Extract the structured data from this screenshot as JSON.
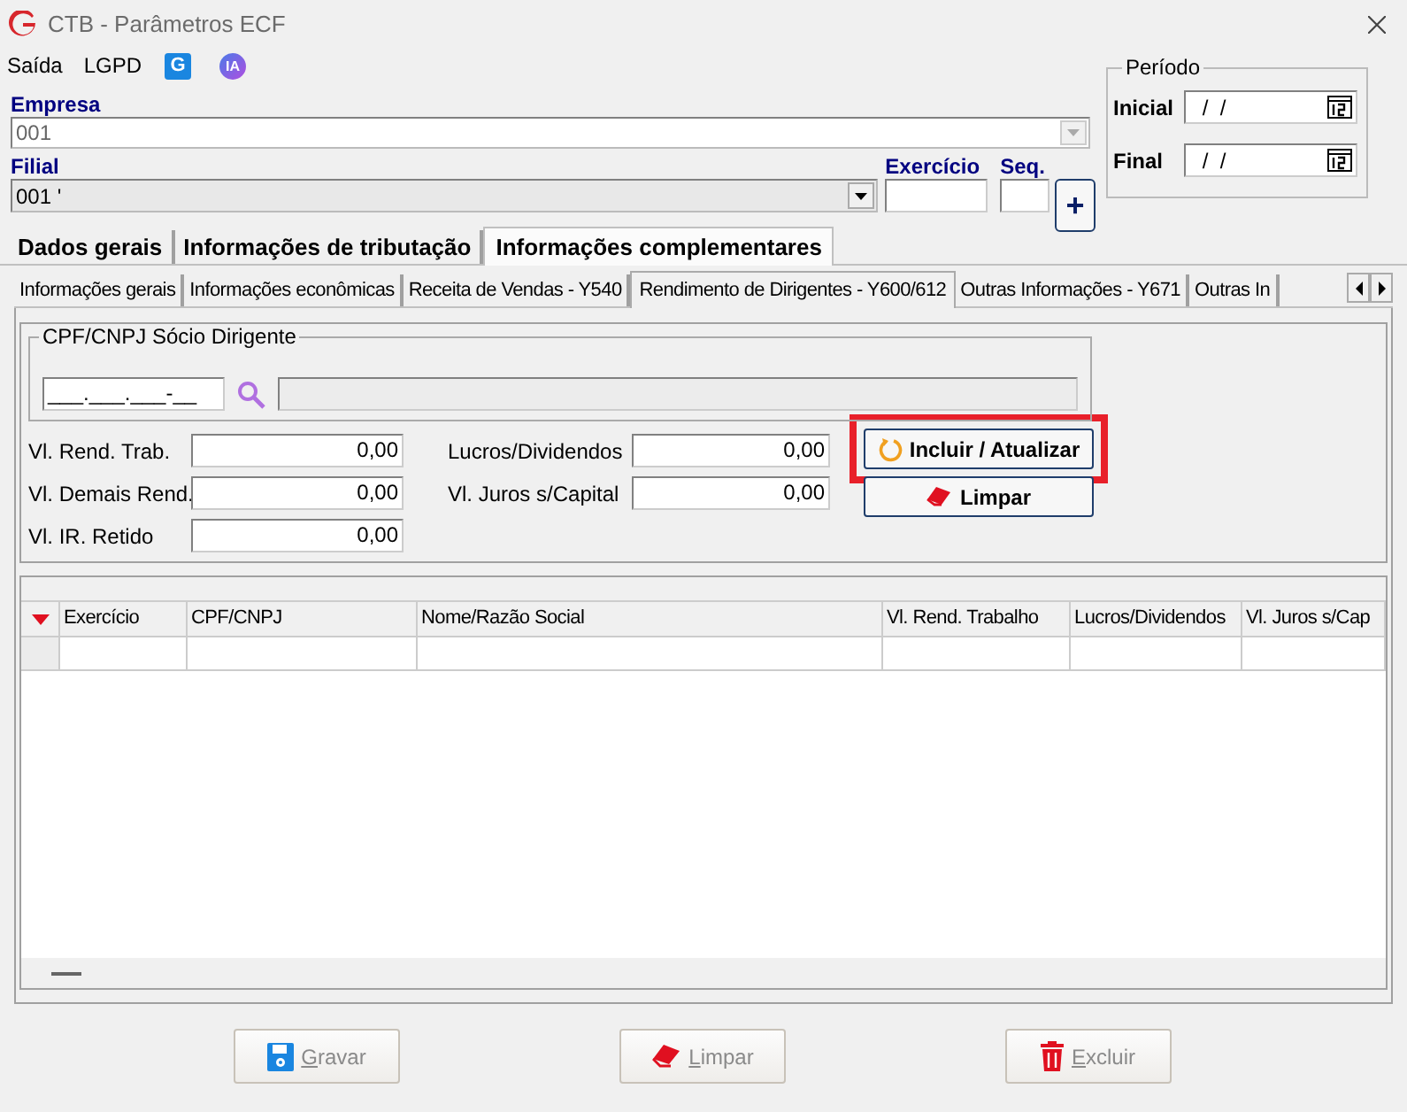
{
  "window": {
    "title": "CTB - Parâmetros ECF"
  },
  "menu": [
    {
      "kind": "text",
      "label": "Saída"
    },
    {
      "kind": "text",
      "label": "LGPD"
    },
    {
      "kind": "square",
      "label": "G"
    },
    {
      "kind": "circle",
      "label": "IA"
    }
  ],
  "empresa": {
    "label": "Empresa",
    "value": "001"
  },
  "filial": {
    "label": "Filial",
    "value": "001 '"
  },
  "exercicio": {
    "label": "Exercício"
  },
  "seq": {
    "label": "Seq."
  },
  "add_button": {
    "label": "+"
  },
  "periodo": {
    "title": "Período",
    "fields": [
      {
        "label": "Inicial",
        "value": " /  /"
      },
      {
        "label": "Final",
        "value": " /  /"
      }
    ]
  },
  "main_tabs": [
    {
      "label": "Dados gerais",
      "selected": false
    },
    {
      "label": "Informações de tributação",
      "selected": false
    },
    {
      "label": "Informações complementares",
      "selected": true
    }
  ],
  "sub_tabs": [
    {
      "label": "Informações gerais",
      "selected": false
    },
    {
      "label": "Informações econômicas",
      "selected": false
    },
    {
      "label": "Receita de Vendas - Y540",
      "selected": false
    },
    {
      "label": "Rendimento de Dirigentes - Y600/612",
      "selected": true
    },
    {
      "label": "Outras Informações - Y671",
      "selected": false
    },
    {
      "label": "Outras In",
      "selected": false
    }
  ],
  "dirigente": {
    "title": "CPF/CNPJ Sócio Dirigente",
    "value": "___.___.___-__"
  },
  "values_left": [
    {
      "label": "Vl. Rend. Trab.",
      "value": "0,00"
    },
    {
      "label": "Vl. Demais Rend.",
      "value": "0,00"
    },
    {
      "label": "Vl. IR. Retido",
      "value": "0,00"
    }
  ],
  "values_right": [
    {
      "label": "Lucros/Dividendos",
      "value": "0,00"
    },
    {
      "label": "Vl. Juros s/Capital",
      "value": "0,00"
    }
  ],
  "actions": [
    {
      "kind": "refresh",
      "label": "Incluir / Atualizar",
      "highlighted": true
    },
    {
      "kind": "eraser",
      "label": "Limpar",
      "highlighted": false
    }
  ],
  "grid": {
    "columns": [
      "Exercício",
      "CPF/CNPJ",
      "Nome/Razão Social",
      "Vl. Rend. Trabalho",
      "Lucros/Dividendos",
      "Vl. Juros s/Cap"
    ]
  },
  "footer_buttons": [
    {
      "kind": "save",
      "label": "Gravar",
      "disabled": true
    },
    {
      "kind": "eraser",
      "label": "Limpar",
      "disabled": true
    },
    {
      "kind": "trash",
      "label": "Excluir",
      "disabled": true
    }
  ]
}
